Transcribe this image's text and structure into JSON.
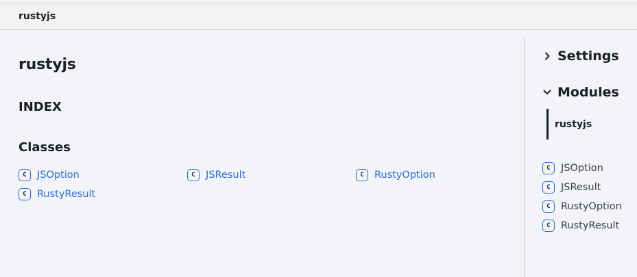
{
  "toolbar": {
    "brand": "rustyjs"
  },
  "main": {
    "title": "rustyjs",
    "index_heading": "INDEX",
    "classes_heading": "Classes",
    "classes": [
      {
        "label": "JSOption",
        "icon": "class-icon",
        "icon_text": "C"
      },
      {
        "label": "JSResult",
        "icon": "class-icon",
        "icon_text": "C"
      },
      {
        "label": "RustyOption",
        "icon": "class-icon",
        "icon_text": "C"
      },
      {
        "label": "RustyResult",
        "icon": "class-icon",
        "icon_text": "C"
      }
    ]
  },
  "sidebar": {
    "settings": {
      "label": "Settings",
      "state": "collapsed",
      "icon": "chevron-right-icon"
    },
    "modules": {
      "label": "Modules",
      "state": "expanded",
      "icon": "chevron-down-icon"
    },
    "module_items": [
      {
        "label": "rustyjs",
        "active": true
      }
    ],
    "links": [
      {
        "label": "JSOption",
        "icon": "class-icon",
        "icon_text": "C"
      },
      {
        "label": "JSResult",
        "icon": "class-icon",
        "icon_text": "C"
      },
      {
        "label": "RustyOption",
        "icon": "class-icon",
        "icon_text": "C"
      },
      {
        "label": "RustyResult",
        "icon": "class-icon",
        "icon_text": "C"
      }
    ]
  },
  "colors": {
    "background": "#f2f4f8",
    "toolbar": "#f2f2f2",
    "link": "#2e6bd0",
    "text": "#1b1f24",
    "divider": "#c9ccd1"
  }
}
